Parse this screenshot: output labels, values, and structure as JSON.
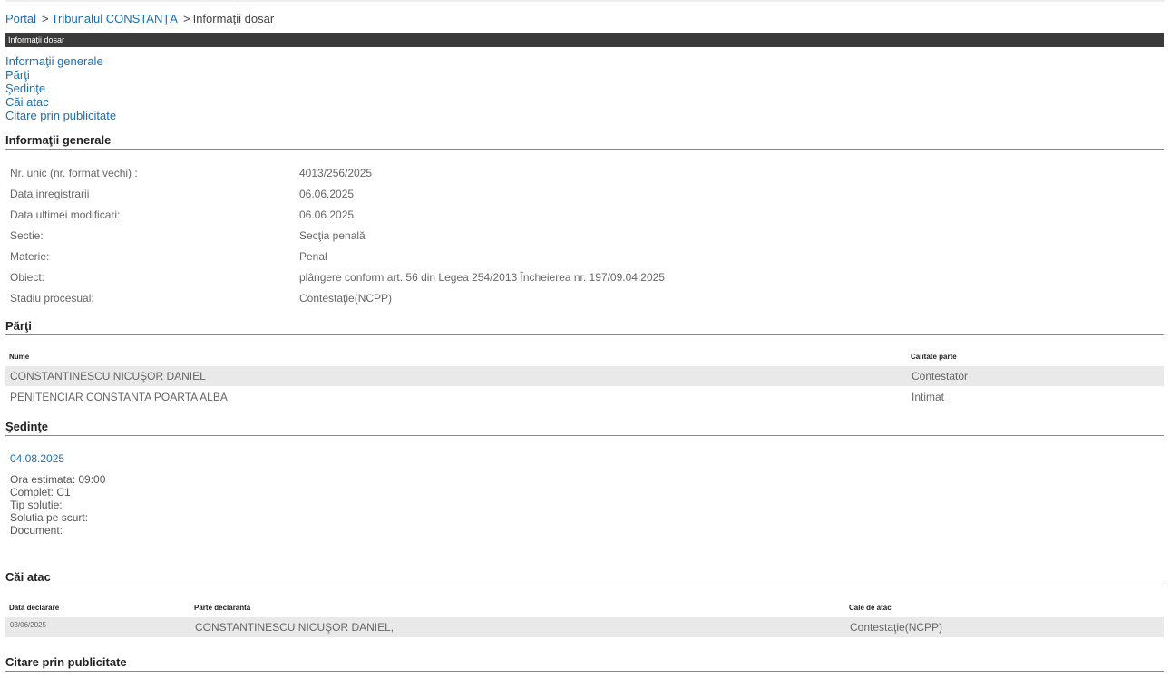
{
  "breadcrumb": {
    "items": [
      "Portal",
      "Tribunalul CONSTANŢA"
    ],
    "separator": ">",
    "current": "Informaţii dosar"
  },
  "titlebar": {
    "label": "Informaţii dosar"
  },
  "toc": [
    "Informaţii generale",
    "Părţi",
    "Şedinţe",
    "Căi atac",
    "Citare prin publicitate"
  ],
  "general": {
    "heading": "Informaţii generale",
    "rows": [
      {
        "label": "Nr. unic (nr. format vechi) :",
        "value": "4013/256/2025"
      },
      {
        "label": "Data inregistrarii",
        "value": "06.06.2025"
      },
      {
        "label": "Data ultimei modificari:",
        "value": "06.06.2025"
      },
      {
        "label": "Sectie:",
        "value": "Secţia penală"
      },
      {
        "label": "Materie:",
        "value": "Penal"
      },
      {
        "label": "Obiect:",
        "value": "plângere conform art. 56 din Legea 254/2013 Încheierea nr. 197/09.04.2025"
      },
      {
        "label": "Stadiu procesual:",
        "value": "Contestaţie(NCPP)"
      }
    ]
  },
  "parties": {
    "heading": "Părţi",
    "columns": [
      "Nume",
      "Calitate parte"
    ],
    "rows": [
      [
        "CONSTANTINESCU NICUŞOR DANIEL",
        "Contestator"
      ],
      [
        "PENITENCIAR CONSTANTA POARTA ALBA",
        "Intimat"
      ]
    ]
  },
  "hearings": {
    "heading": "Şedinţe",
    "date": "04.08.2025",
    "lines": [
      "Ora estimata: 09:00",
      "Complet: C1",
      "Tip solutie:",
      "Solutia pe scurt:",
      "Document:"
    ]
  },
  "appeals": {
    "heading": "Căi atac",
    "columns": [
      "Dată declarare",
      "Parte declarantă",
      "Cale de atac"
    ],
    "rows": [
      [
        "03/06/2025",
        "CONSTANTINESCU NICUŞOR DANIEL,",
        "Contestaţie(NCPP)"
      ]
    ]
  },
  "publication": {
    "heading": "Citare prin publicitate"
  }
}
